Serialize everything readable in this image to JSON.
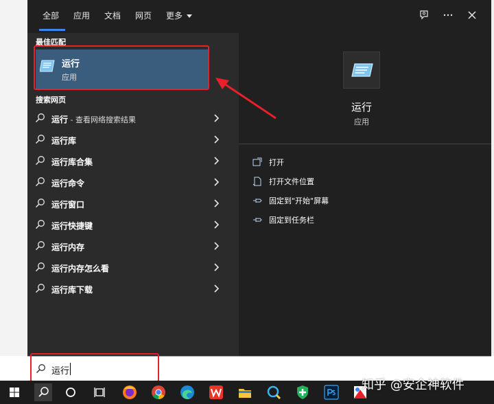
{
  "tabs": [
    {
      "label": "全部",
      "active": true
    },
    {
      "label": "应用"
    },
    {
      "label": "文档"
    },
    {
      "label": "网页"
    },
    {
      "label": "更多"
    }
  ],
  "sections": {
    "best_match": "最佳匹配",
    "web_search": "搜索网页"
  },
  "best_match": {
    "title": "运行",
    "subtitle": "应用"
  },
  "web_results": [
    {
      "bold": "运行",
      "suffix": " - 查看网络搜索结果"
    },
    {
      "bold": "运行库",
      "suffix": ""
    },
    {
      "bold": "运行库合集",
      "suffix": ""
    },
    {
      "bold": "运行命令",
      "suffix": ""
    },
    {
      "bold": "运行窗口",
      "suffix": ""
    },
    {
      "bold": "运行快捷键",
      "suffix": ""
    },
    {
      "bold": "运行内存",
      "suffix": ""
    },
    {
      "bold": "运行内存怎么看",
      "suffix": ""
    },
    {
      "bold": "运行库下载",
      "suffix": ""
    }
  ],
  "detail": {
    "title": "运行",
    "subtitle": "应用",
    "actions": [
      {
        "label": "打开",
        "icon": "open-icon"
      },
      {
        "label": "打开文件位置",
        "icon": "file-location-icon"
      },
      {
        "label": "固定到\"开始\"屏幕",
        "icon": "pin-icon"
      },
      {
        "label": "固定到任务栏",
        "icon": "pin-icon"
      }
    ]
  },
  "search": {
    "value": "运行"
  },
  "watermark": "知乎 @安企神软件",
  "colors": {
    "accent": "#3a86f5",
    "highlight": "#3b5d7d",
    "annotation": "#e8202a"
  },
  "taskbar_icons": [
    "windows-start-icon",
    "search-icon",
    "cortana-icon",
    "task-view-icon",
    "firefox-icon",
    "chrome-icon",
    "edge-icon",
    "wps-icon",
    "file-explorer-icon",
    "app-icon",
    "security-icon",
    "photoshop-icon",
    "paint-icon"
  ]
}
